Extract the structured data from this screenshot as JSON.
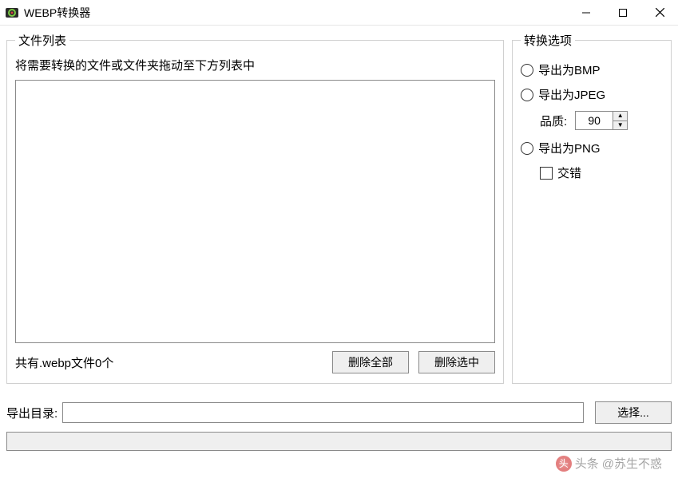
{
  "window": {
    "title": "WEBP转换器"
  },
  "file_list": {
    "legend": "文件列表",
    "hint": "将需要转换的文件或文件夹拖动至下方列表中",
    "count_label": "共有.webp文件0个",
    "delete_all_label": "删除全部",
    "delete_selected_label": "删除选中"
  },
  "options": {
    "legend": "转换选项",
    "export_bmp": "导出为BMP",
    "export_jpeg": "导出为JPEG",
    "quality_label": "品质:",
    "quality_value": "90",
    "export_png": "导出为PNG",
    "interlace_label": "交错"
  },
  "export": {
    "label": "导出目录:",
    "path": "",
    "browse_label": "选择..."
  },
  "watermark": {
    "prefix": "头条",
    "text": "@苏生不惑"
  }
}
